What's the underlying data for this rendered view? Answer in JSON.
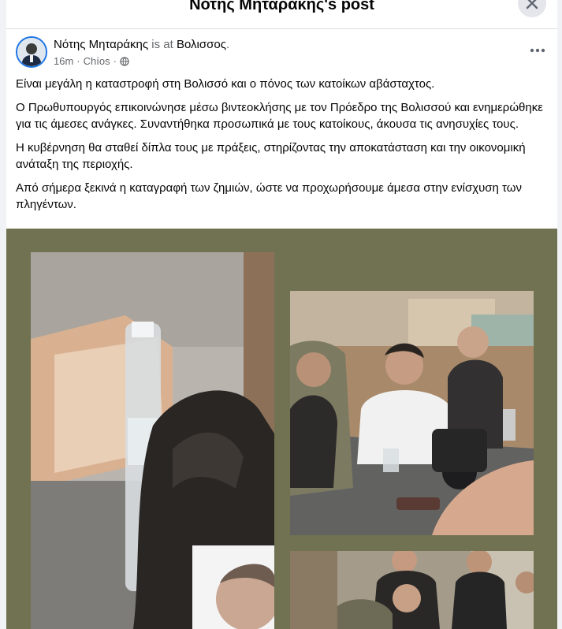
{
  "dialog": {
    "title": "Νότης Μηταράκης's post",
    "close_icon": "close-icon"
  },
  "post": {
    "author": "Νότης Μηταράκης",
    "is_at": " is at ",
    "location": "Βολισσος",
    "location_suffix": ".",
    "time": "16m",
    "separator": "·",
    "place": "Chíos",
    "privacy_icon": "globe-icon",
    "more_icon": "more-options-icon",
    "paragraphs": [
      "Είναι μεγάλη η καταστροφή στη Βολισσό και ο πόνος των κατοίκων αβάσταχτος.",
      "Ο Πρωθυπουργός επικοινώνησε μέσω βιντεοκλήσης με τον Πρόεδρο της Βολισσού και ενημερώθηκε για τις άμεσες ανάγκες. Συναντήθηκα προσωπικά με τους κατοίκους, άκουσα τις ανησυχίες τους.",
      "Η κυβέρνηση θα σταθεί δίπλα τους με πράξεις, στηρίζοντας την αποκατάσταση και την οικονομική ανάταξη της περιοχής.",
      "Από σήμερα ξεκινά η καταγραφή των ζημιών, ώστε να προχωρήσουμε άμεσα στην ενίσχυση των πληγέντων."
    ]
  },
  "colors": {
    "photo_background": "#707251",
    "link_blue": "#1b74e4",
    "secondary_text": "#65676b"
  }
}
